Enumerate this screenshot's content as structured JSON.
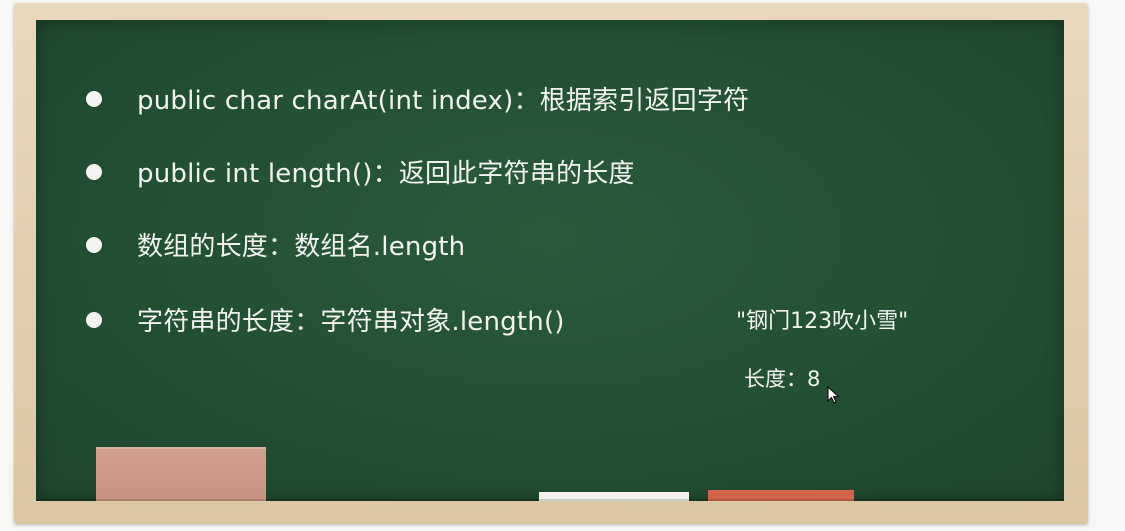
{
  "bullets": [
    {
      "text": "public char charAt(int index)：根据索引返回字符"
    },
    {
      "text": "public int length()：返回此字符串的长度"
    },
    {
      "text": "数组的长度：数组名.length"
    },
    {
      "text": "字符串的长度：字符串对象.length()"
    }
  ],
  "example": {
    "string_literal": "\"钢门123吹小雪\"",
    "length_line": "长度：8"
  },
  "colors": {
    "board": "#234f33",
    "frame": "#dcc6a3",
    "chalk_text": "#f2f2ef",
    "eraser": "#c7927f",
    "chalk_red": "#d4634b",
    "chalk_white": "#f1f1ee"
  }
}
